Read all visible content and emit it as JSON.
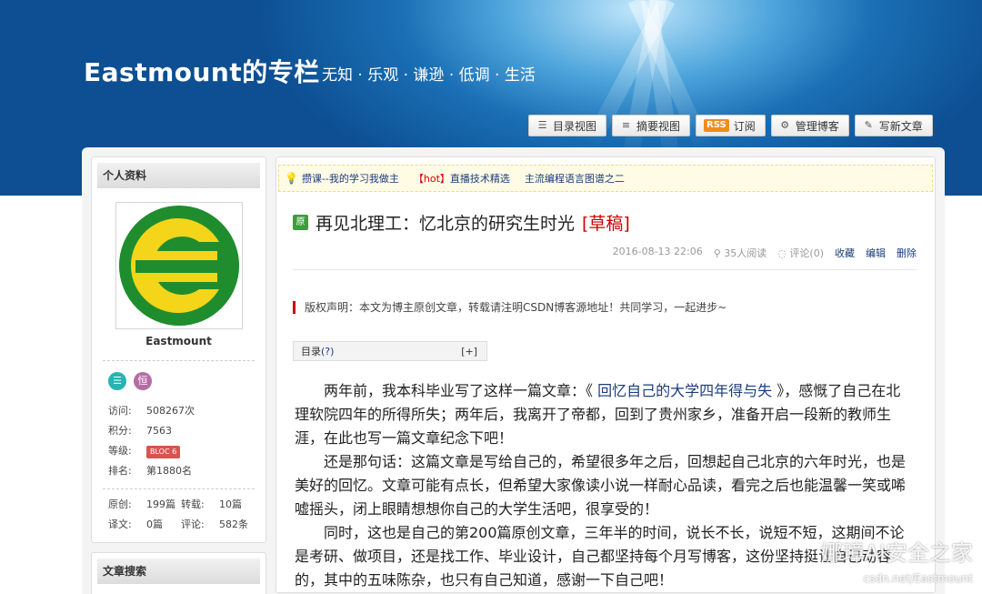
{
  "header": {
    "site_title": "Eastmount的专栏",
    "slogan": "无知 · 乐观 · 谦逊 · 低调 · 生活",
    "toolbar": [
      {
        "label": "目录视图",
        "icon": "list-icon"
      },
      {
        "label": "摘要视图",
        "icon": "summary-icon"
      },
      {
        "label": "订阅",
        "icon": "rss-icon",
        "badge": "RSS"
      },
      {
        "label": "管理博客",
        "icon": "gear-icon"
      },
      {
        "label": "写新文章",
        "icon": "edit-icon"
      }
    ]
  },
  "sidebar": {
    "profile_heading": "个人资料",
    "username": "Eastmount",
    "stats": [
      {
        "key": "访问:",
        "value": "508267次"
      },
      {
        "key": "积分:",
        "value": "7563"
      },
      {
        "key": "等级:",
        "value": "BLOC 6"
      },
      {
        "key": "排名:",
        "value": "第1880名"
      }
    ],
    "counts": {
      "original_key": "原创:",
      "original_value": "199篇",
      "repost_key": "转载:",
      "repost_value": "10篇",
      "translate_key": "译文:",
      "translate_value": "0篇",
      "comment_key": "评论:",
      "comment_value": "582条"
    },
    "search_heading": "文章搜索"
  },
  "notice": {
    "item1": "攒课--我的学习我做主",
    "item2_hot": "【hot】",
    "item2": "直播技术精选",
    "item3": "主流编程语言图谱之二"
  },
  "article": {
    "badge": "原",
    "title": "再见北理工：忆北京的研究生时光",
    "draft_tag": "[草稿]",
    "date": "2016-08-13 22:06",
    "reads": "35人阅读",
    "comments": "评论(0)",
    "favorite": "收藏",
    "edit": "编辑",
    "delete": "删除",
    "copyright": "版权声明：本文为博主原创文章，转载请注明CSDN博客源地址！共同学习，一起进步~",
    "toc_label": "目录",
    "toc_q": "(?)",
    "toc_toggle": "[+]",
    "p1_a": "两年前，我本科毕业写了这样一篇文章：《 ",
    "p1_link": "回忆自己的大学四年得与失",
    "p1_b": " 》，感慨了自己在北理软院四年的所得所失；两年后，我离开了帝都，回到了贵州家乡，准备开启一段新的教师生涯，在此也写一篇文章纪念下吧！",
    "p2": "还是那句话：这篇文章是写给自己的，希望很多年之后，回想起自己北京的六年时光，也是美好的回忆。文章可能有点长，但希望大家像读小说一样耐心品读，看完之后也能温馨一笑或唏嘘摇头，闭上眼睛想想你自己的大学生活吧，很享受的！",
    "p3": "同时，这也是自己的第200篇原创文章，三年半的时间，说长不长，说短不短，这期间不论是考研、做项目，还是找工作、毕业设计，自己都坚持每个月写博客，这份坚持挺让自己动容的，其中的五味陈杂，也只有自己知道，感谢一下自己吧！"
  },
  "watermark": {
    "text": "娜璋AI安全之家",
    "url": "csdn.net/Eastmount"
  },
  "colors": {
    "banner": "#1a6fb5",
    "link": "#1a3d7c",
    "draft": "#cc0000",
    "orig_badge": "#3e9d3e"
  }
}
